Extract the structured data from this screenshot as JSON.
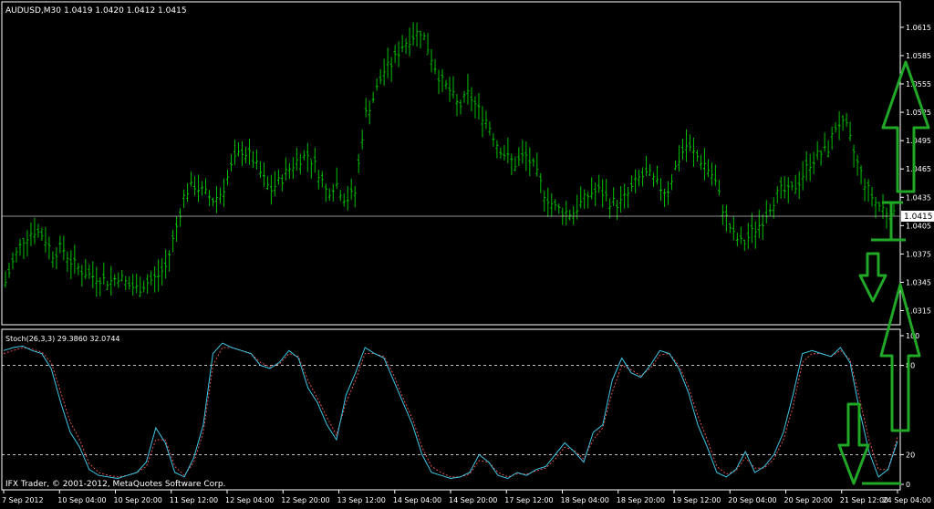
{
  "header": {
    "symbol_label": "AUDUSD,M30",
    "ohlc_label": "1.0419 1.0420 1.0412 1.0415"
  },
  "footer": {
    "copyright": "IFX Trader, © 2001-2012, MetaQuotes Software Corp."
  },
  "colors": {
    "background": "#000000",
    "bars": "#00c000",
    "grid_frame": "#ffffff",
    "stoch_main": "#3fc7e6",
    "stoch_signal": "#e05050",
    "arrows": "#21a826",
    "price_line": "#c0c0c0"
  },
  "chart_data": [
    {
      "type": "line",
      "title": "AUDUSD,M30",
      "subtitle": "1.0419 1.0420 1.0412 1.0415",
      "price_axis_ticks": [
        "1.0615",
        "1.0585",
        "1.0555",
        "1.0525",
        "1.0495",
        "1.0465",
        "1.0435",
        "1.0405",
        "1.0375",
        "1.0345",
        "1.0315"
      ],
      "ylim": [
        1.0302,
        1.064
      ],
      "current_price": "1.0415",
      "time_axis_labels": [
        "7 Sep 2012",
        "10 Sep 04:00",
        "10 Sep 20:00",
        "11 Sep 12:00",
        "12 Sep 04:00",
        "12 Sep 20:00",
        "13 Sep 12:00",
        "14 Sep 04:00",
        "14 Sep 20:00",
        "17 Sep 12:00",
        "18 Sep 04:00",
        "18 Sep 20:00",
        "19 Sep 12:00",
        "20 Sep 04:00",
        "20 Sep 20:00",
        "21 Sep 12:00",
        "24 Sep 04:00"
      ],
      "series": [
        {
          "values": [
            1.0345,
            1.0372,
            1.0392,
            1.04,
            1.0395,
            1.0375,
            1.0382,
            1.0366,
            1.0358,
            1.0352,
            1.035,
            1.0345,
            1.0352,
            1.0342,
            1.0338,
            1.0345,
            1.035,
            1.0362,
            1.04,
            1.044,
            1.0448,
            1.044,
            1.0432,
            1.0442,
            1.047,
            1.0485,
            1.0478,
            1.046,
            1.0442,
            1.0452,
            1.0465,
            1.0475,
            1.048,
            1.0465,
            1.044,
            1.045,
            1.0432,
            1.044,
            1.052,
            1.0542,
            1.0568,
            1.0578,
            1.0596,
            1.0605,
            1.0612,
            1.0585,
            1.056,
            1.0548,
            1.053,
            1.0545,
            1.0528,
            1.0515,
            1.0492,
            1.0478,
            1.047,
            1.048,
            1.0465,
            1.044,
            1.0425,
            1.042,
            1.0418,
            1.043,
            1.044,
            1.0442,
            1.043,
            1.0428,
            1.044,
            1.0455,
            1.046,
            1.0448,
            1.044,
            1.047,
            1.049,
            1.048,
            1.047,
            1.0455,
            1.042,
            1.0395,
            1.0385,
            1.0398,
            1.0408,
            1.0428,
            1.0442,
            1.044,
            1.0452,
            1.047,
            1.048,
            1.0485,
            1.0515,
            1.0508,
            1.0475,
            1.0448,
            1.043,
            1.0422,
            1.0415
          ]
        }
      ]
    },
    {
      "type": "line",
      "title": "Stoch(26,3,3) 29.3860 32.0744",
      "ylim": [
        0,
        100
      ],
      "y_axis_ticks": [
        "100",
        "80",
        "20",
        "0"
      ],
      "series": [
        {
          "name": "main",
          "values": [
            90,
            92,
            93,
            90,
            88,
            78,
            55,
            35,
            25,
            10,
            6,
            5,
            4,
            6,
            8,
            15,
            38,
            28,
            8,
            5,
            18,
            40,
            88,
            95,
            92,
            90,
            88,
            80,
            78,
            82,
            90,
            85,
            65,
            55,
            40,
            30,
            60,
            75,
            92,
            88,
            85,
            70,
            55,
            40,
            20,
            8,
            6,
            4,
            5,
            8,
            20,
            15,
            6,
            4,
            8,
            6,
            10,
            12,
            20,
            28,
            22,
            15,
            35,
            40,
            70,
            85,
            75,
            72,
            80,
            90,
            88,
            78,
            62,
            40,
            25,
            8,
            5,
            10,
            22,
            8,
            12,
            20,
            35,
            60,
            88,
            90,
            88,
            86,
            92,
            82,
            50,
            22,
            5,
            10,
            29
          ]
        },
        {
          "name": "signal",
          "values": [
            88,
            90,
            92,
            91,
            89,
            82,
            62,
            42,
            30,
            14,
            8,
            6,
            5,
            6,
            8,
            12,
            30,
            30,
            12,
            6,
            15,
            35,
            80,
            92,
            92,
            90,
            88,
            82,
            79,
            81,
            88,
            86,
            70,
            58,
            45,
            33,
            55,
            70,
            88,
            88,
            86,
            74,
            58,
            44,
            25,
            12,
            8,
            5,
            5,
            7,
            16,
            15,
            8,
            5,
            7,
            7,
            9,
            11,
            17,
            25,
            23,
            17,
            30,
            38,
            62,
            80,
            77,
            73,
            78,
            87,
            88,
            80,
            66,
            46,
            30,
            12,
            7,
            9,
            18,
            11,
            11,
            17,
            30,
            52,
            82,
            88,
            88,
            86,
            90,
            84,
            58,
            30,
            10,
            10,
            32
          ]
        }
      ]
    }
  ]
}
